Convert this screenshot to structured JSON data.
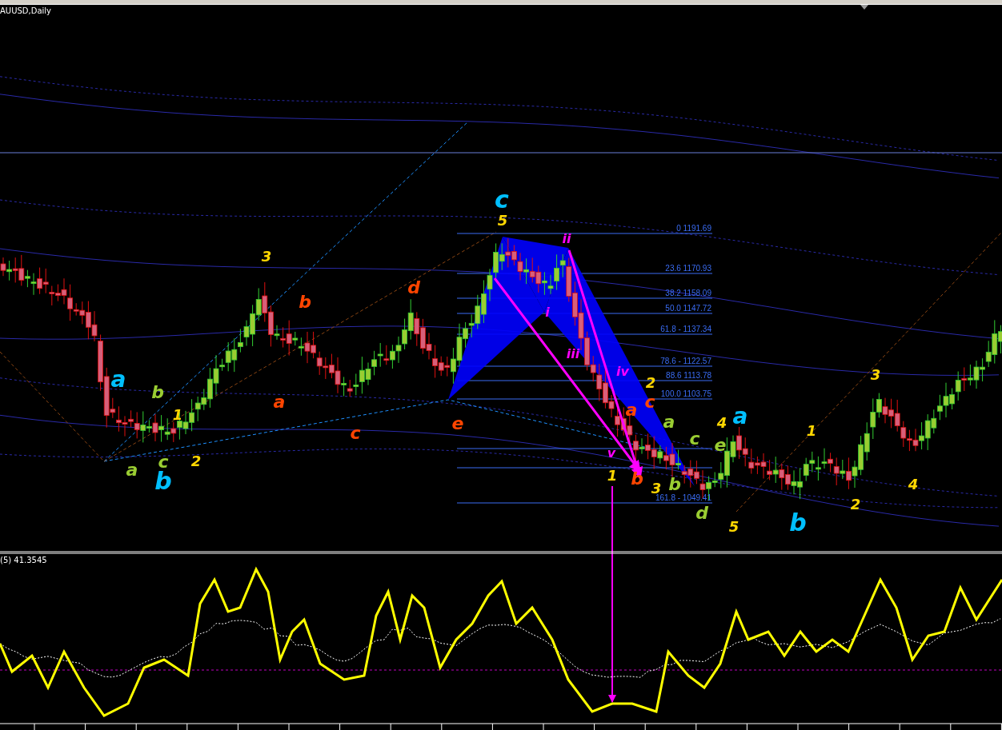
{
  "chart": {
    "title": "AUUSD,Daily",
    "fib_levels": [
      {
        "label": "0 1191.69"
      },
      {
        "label": "23.6 1170.93"
      },
      {
        "label": "38.2 1158.09"
      },
      {
        "label": "50.0 1147.72"
      },
      {
        "label": "61.8 - 1137.34"
      },
      {
        "label": "78.6 - 1122.57"
      },
      {
        "label": "88.6 1113.78"
      },
      {
        "label": "100.0 1103.75"
      },
      {
        "label": "161.8 - 1049.41"
      }
    ],
    "wave_labels": [
      {
        "text": "c",
        "color": "#00bfff"
      },
      {
        "text": "a",
        "color": "#00bfff"
      },
      {
        "text": "b",
        "color": "#00bfff"
      },
      {
        "text": "a",
        "color": "#00bfff"
      },
      {
        "text": "b",
        "color": "#00bfff"
      },
      {
        "text": "5",
        "color": "#ffd700"
      },
      {
        "text": "3",
        "color": "#ffd700"
      },
      {
        "text": "1",
        "color": "#ffd700"
      },
      {
        "text": "2",
        "color": "#ffd700"
      },
      {
        "text": "2",
        "color": "#ffd700"
      },
      {
        "text": "4",
        "color": "#ffd700"
      },
      {
        "text": "1",
        "color": "#ffd700"
      },
      {
        "text": "3",
        "color": "#ffd700"
      },
      {
        "text": "5",
        "color": "#ffd700"
      },
      {
        "text": "1",
        "color": "#ffd700"
      },
      {
        "text": "3",
        "color": "#ffd700"
      },
      {
        "text": "4",
        "color": "#ffd700"
      },
      {
        "text": "2",
        "color": "#ffd700"
      },
      {
        "text": "b",
        "color": "#ff4500"
      },
      {
        "text": "d",
        "color": "#ff4500"
      },
      {
        "text": "a",
        "color": "#ff4500"
      },
      {
        "text": "c",
        "color": "#ff4500"
      },
      {
        "text": "e",
        "color": "#ff4500"
      },
      {
        "text": "a",
        "color": "#ff4500"
      },
      {
        "text": "c",
        "color": "#ff4500"
      },
      {
        "text": "b",
        "color": "#ff4500"
      },
      {
        "text": "b",
        "color": "#9acd32"
      },
      {
        "text": "a",
        "color": "#9acd32"
      },
      {
        "text": "c",
        "color": "#9acd32"
      },
      {
        "text": "a",
        "color": "#9acd32"
      },
      {
        "text": "c",
        "color": "#9acd32"
      },
      {
        "text": "e",
        "color": "#9acd32"
      },
      {
        "text": "b",
        "color": "#9acd32"
      },
      {
        "text": "d",
        "color": "#9acd32"
      },
      {
        "text": "ii",
        "color": "#ff00ff"
      },
      {
        "text": "i",
        "color": "#ff00ff"
      },
      {
        "text": "iii",
        "color": "#ff00ff"
      },
      {
        "text": "iv",
        "color": "#ff00ff"
      },
      {
        "text": "v",
        "color": "#ff00ff"
      }
    ]
  },
  "indicator": {
    "label": "(5) 41.3545"
  }
}
